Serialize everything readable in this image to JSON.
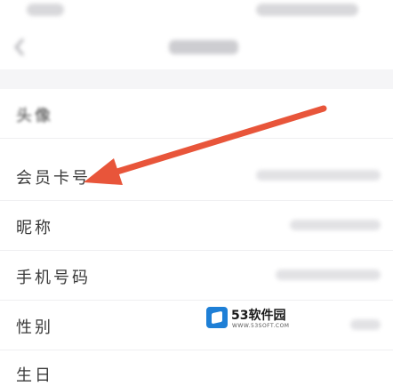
{
  "profile": {
    "rows": [
      {
        "label": "头像"
      },
      {
        "label": "会员卡号"
      },
      {
        "label": "昵称"
      },
      {
        "label": "手机号码"
      },
      {
        "label": "性别"
      },
      {
        "label": "生日"
      }
    ]
  },
  "annotation": {
    "arrow_color": "#e8553a"
  },
  "watermark": {
    "brand": "53软件园",
    "domain": "WWW.53SOFT.COM"
  },
  "icons": {
    "back": "chevron-left-icon",
    "avatar": "avatar-image"
  }
}
